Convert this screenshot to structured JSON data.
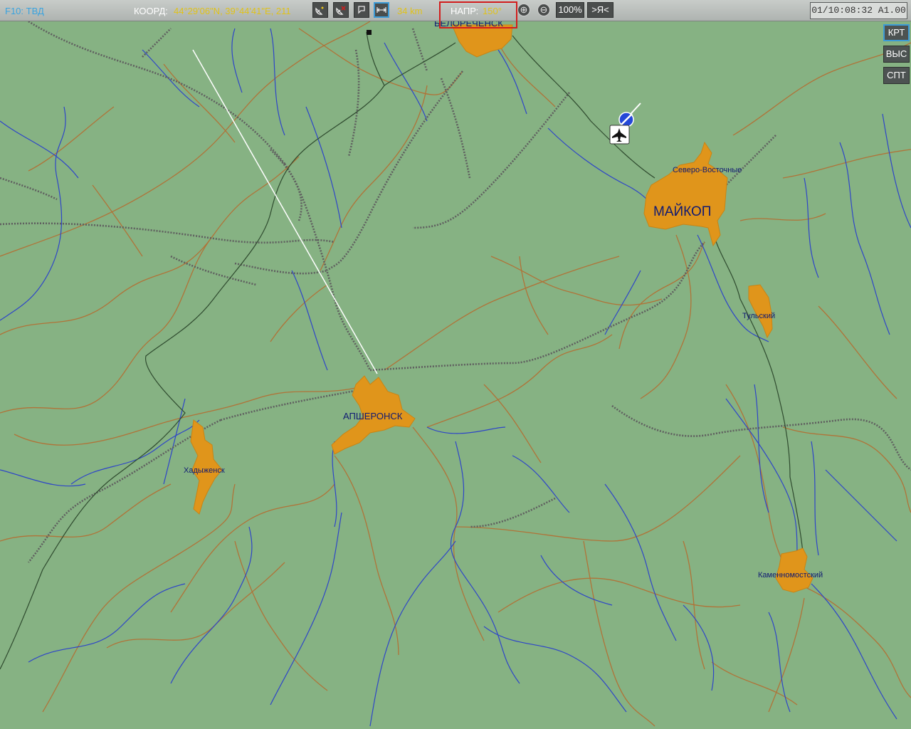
{
  "toolbar": {
    "mode": "F10: ТВД",
    "coord_label": "КООРД:",
    "coord_value": "44°29'06\"N, 39°44'41\"E, 211",
    "scale": "34 km",
    "heading_label": "НАПР:",
    "heading_value": "150°",
    "zoom_in": "⊕",
    "zoom_out": "⊖",
    "zoom_level": "100%",
    "me_button": ">Я<",
    "time": "01/10:08:32 A1.00"
  },
  "side_buttons": [
    "КРТ",
    "ВЫС",
    "СПТ"
  ],
  "map": {
    "cities": [
      {
        "name": "БЕЛОРЕЧЕНСК"
      },
      {
        "name": "Северо-Восточные"
      },
      {
        "name": "МАЙКОП"
      },
      {
        "name": "Тульский"
      },
      {
        "name": "АПШЕРОНСК"
      },
      {
        "name": "Хадыженск"
      },
      {
        "name": "Каменномостский"
      }
    ]
  },
  "colors": {
    "terrain": "#86b283",
    "city": "#e0951b",
    "river": "#2e45c8",
    "road": "#b07338",
    "railway": "#5f5f5f",
    "label": "#101a73",
    "highlight": "#d21d1d",
    "accent": "#3c9bd6"
  }
}
